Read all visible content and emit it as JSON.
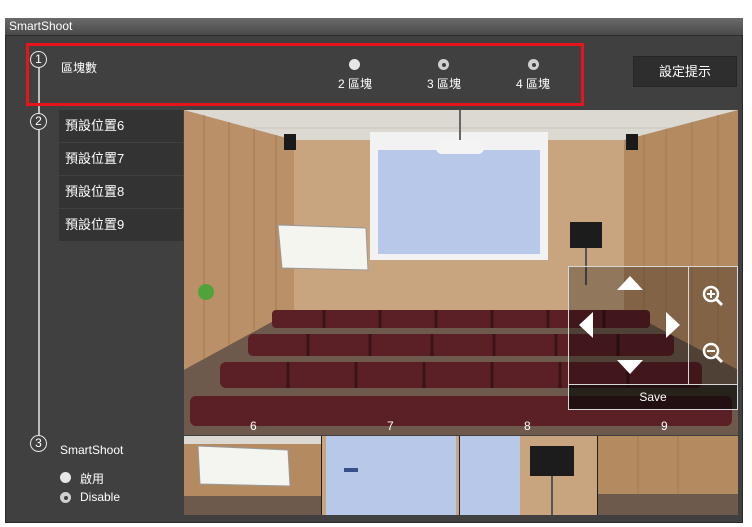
{
  "window": {
    "title": "SmartShoot"
  },
  "steps": {
    "one": "1",
    "two": "2",
    "three": "3"
  },
  "blocks": {
    "label": "區塊數",
    "options": [
      "2 區塊",
      "3 區塊",
      "4 區塊"
    ],
    "selected_index": 0
  },
  "hint_button": "設定提示",
  "presets": [
    "預設位置6",
    "預設位置7",
    "預設位置8",
    "預設位置9"
  ],
  "controls": {
    "save_label": "Save"
  },
  "strip_labels": [
    "6",
    "7",
    "8",
    "9"
  ],
  "smartshoot": {
    "label": "SmartShoot",
    "options": [
      "啟用",
      "Disable"
    ],
    "selected_index": 0
  }
}
